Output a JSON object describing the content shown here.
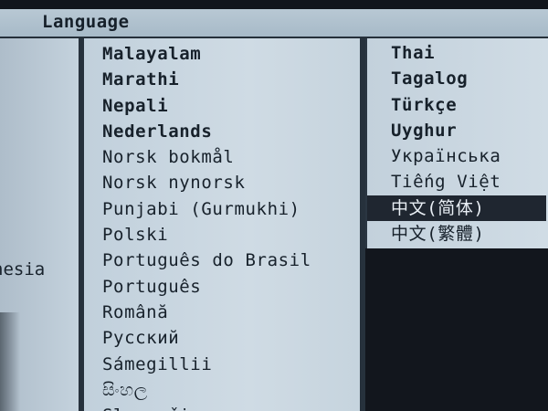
{
  "header": {
    "title": "Language"
  },
  "left_column": {
    "fragment": "nesia"
  },
  "middle_column": {
    "items": [
      "Malayalam",
      "Marathi",
      "Nepali",
      "Nederlands",
      "Norsk bokmål",
      "Norsk nynorsk",
      "Punjabi (Gurmukhi)",
      "Polski",
      "Português do Brasil",
      "Português",
      "Română",
      "Русский",
      "Sámegillii",
      "සිංහල",
      "Slovenčina"
    ]
  },
  "right_column": {
    "items": [
      "Thai",
      "Tagalog",
      "Türkçe",
      "Uyghur",
      "Українська",
      "Tiếng Việt",
      "中文(简体)",
      "中文(繁體)"
    ],
    "selected_index": 6
  },
  "colors": {
    "list_background": "#cbd8e2",
    "text": "#17212b",
    "selection_background": "#1f2630",
    "selection_text": "#e8eef4",
    "screen_background": "#11151c"
  }
}
